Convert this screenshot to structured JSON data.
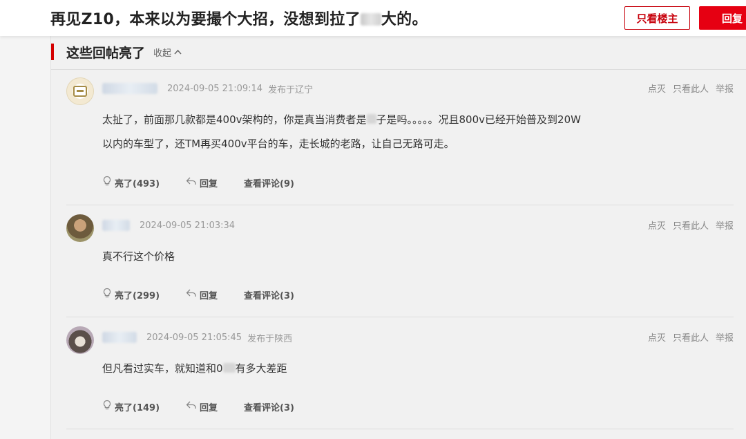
{
  "header": {
    "title_part1": "再见Z10，本来以为要撮个大招，没想到拉了",
    "title_part2": "大的。",
    "only_op_label": "只看楼主",
    "reply_label": "回复"
  },
  "section": {
    "title": "这些回帖亮了",
    "collapse_label": "收起"
  },
  "comments": [
    {
      "time": "2024-09-05 21:09:14",
      "location": "发布于辽宁",
      "text_line1_a": "太扯了，前面那几款都是400v架构的，你是真当消费者是",
      "text_line1_b": "子是吗。。。。。况且800v已经开始普及到20W",
      "text_line2": "以内的车型了，还TM再买400v平台的车，走长城的老路，让自己无路可走。",
      "like_label": "亮了(493)",
      "reply_label": "回复",
      "view_label": "查看评论(9)"
    },
    {
      "time": "2024-09-05 21:03:34",
      "location": "",
      "text_line1_a": "真不行这个价格",
      "like_label": "亮了(299)",
      "reply_label": "回复",
      "view_label": "查看评论(3)"
    },
    {
      "time": "2024-09-05 21:05:45",
      "location": "发布于陕西",
      "text_line1_a": "但凡看过实车，就知道和0",
      "text_line1_b": "有多大差距",
      "like_label": "亮了(149)",
      "reply_label": "回复",
      "view_label": "查看评论(3)"
    }
  ],
  "actions": {
    "dislike": "点灭",
    "only_this": "只看此人",
    "report": "举报"
  },
  "icons": {
    "like": "lightbulb-icon",
    "reply": "reply-arrow-icon",
    "collapse": "chevron-up-icon"
  },
  "colors": {
    "accent": "#e60012",
    "section_bar": "#d40000"
  }
}
